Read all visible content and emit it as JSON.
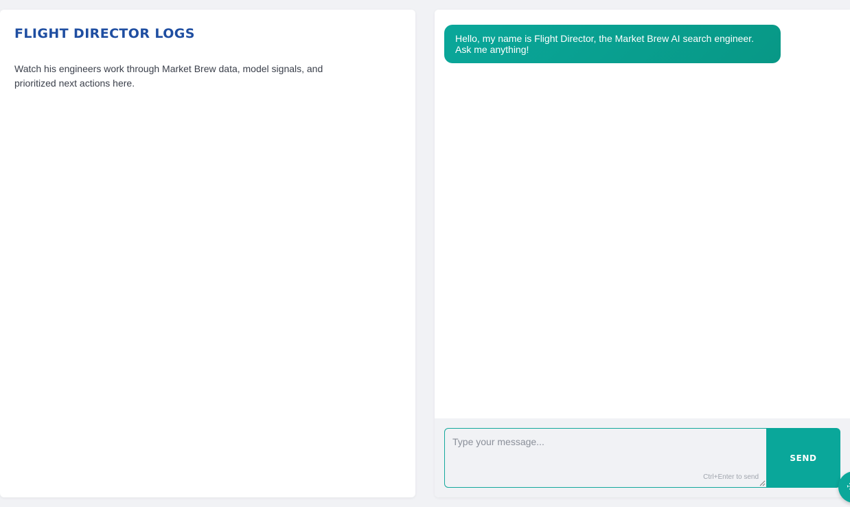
{
  "logs_panel": {
    "title": "Flight Director Logs",
    "description": "Watch his engineers work through Market Brew data, model signals, and prioritized next actions here."
  },
  "chat": {
    "messages": [
      {
        "role": "assistant",
        "text": "Hello, my name is Flight Director, the Market Brew AI search engineer. Ask me anything!"
      }
    ],
    "input": {
      "placeholder": "Type your message...",
      "value": "",
      "hint": "Ctrl+Enter to send"
    },
    "send_label": "Send"
  },
  "colors": {
    "accent": "#0aa79a",
    "title": "#1f4ea1",
    "background": "#f1f2f5"
  },
  "icons": {
    "floating_button": "chat-launcher-icon"
  }
}
